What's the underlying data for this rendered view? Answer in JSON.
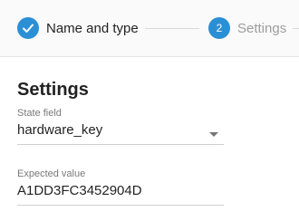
{
  "stepper": {
    "steps": [
      {
        "label": "Name and type",
        "status": "completed",
        "icon": "check-icon"
      },
      {
        "label": "Settings",
        "number": "2",
        "status": "active"
      }
    ],
    "accent_color": "#2a8fd5"
  },
  "section": {
    "title": "Settings"
  },
  "state_field": {
    "label": "State field",
    "value": "hardware_key",
    "icon": "dropdown-arrow-icon"
  },
  "expected_value": {
    "label": "Expected value",
    "value": "A1DD3FC3452904D"
  }
}
